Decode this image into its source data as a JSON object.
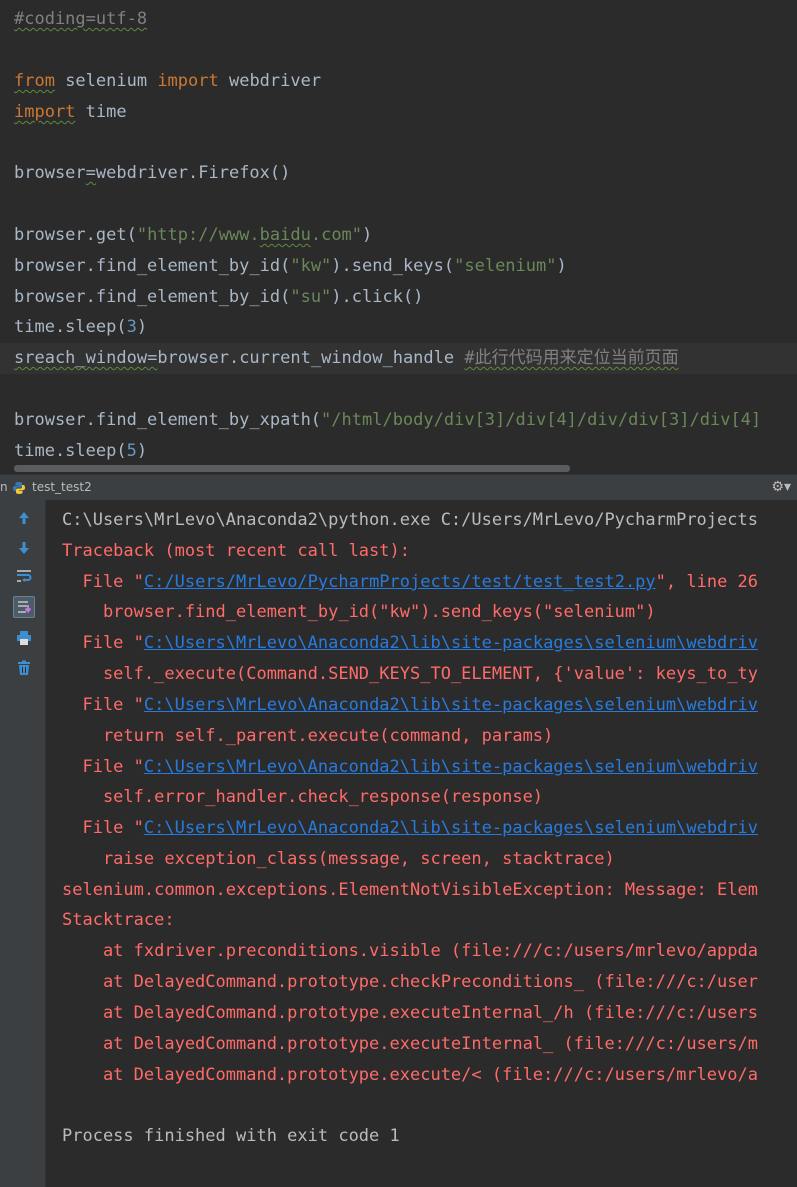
{
  "editor": {
    "lines": {
      "l1": "#coding=utf-8",
      "l3_from": "from",
      "l3_rest": " selenium ",
      "l3_import": "import",
      "l3_mod": " webdriver",
      "l4_import": "import",
      "l4_rest": " time",
      "l6_a": "browser",
      "l6_eq": "=",
      "l6_b": "webdriver.Firefox()",
      "l8_a": "browser.get(",
      "l8_s1": "\"http://www.",
      "l8_s2": "baidu",
      "l8_s3": ".com\"",
      "l8_b": ")",
      "l9_a": "browser.find_element_by_id(",
      "l9_s": "\"kw\"",
      "l9_b": ").send_keys(",
      "l9_s2": "\"selenium\"",
      "l9_c": ")",
      "l10_a": "browser.find_element_by_id(",
      "l10_s": "\"su\"",
      "l10_b": ").click()",
      "l11_a": "time.sleep(",
      "l11_n": "3",
      "l11_b": ")",
      "l12_a": "sreach_window",
      "l12_eq": "=",
      "l12_b": "browser.current_window_handle ",
      "l12_c": "#此行代码用来定位当前页面",
      "l14_a": "browser.find_element_by_xpath(",
      "l14_s": "\"/html/body/div[3]/div[4]/div/div[3]/div[4]",
      "l15_a": "time.sleep(",
      "l15_n": "5",
      "l15_b": ")"
    }
  },
  "run_panel": {
    "prefix": "n",
    "tab_label": "test_test2",
    "gear": "⚙▾"
  },
  "toolbar": {
    "icons": [
      "up-arrow-icon",
      "down-arrow-icon",
      "soft-wrap-icon",
      "scroll-to-end-icon",
      "print-icon",
      "trash-icon"
    ]
  },
  "console": {
    "c1": "C:\\Users\\MrLevo\\Anaconda2\\python.exe C:/Users/MrLevo/PycharmProjects",
    "c2": "Traceback (most recent call last):",
    "c3_pre": "  File ",
    "c3_q1": "\"",
    "c3_link": "C:/Users/MrLevo/PycharmProjects/test/test_test2.py",
    "c3_post": "\", line 26",
    "c4": "    browser.find_element_by_id(\"kw\").send_keys(\"selenium\")",
    "c5_pre": "  File ",
    "c5_q1": "\"",
    "c5_link": "C:\\Users\\MrLevo\\Anaconda2\\lib\\site-packages\\selenium\\webdriv",
    "c6": "    self._execute(Command.SEND_KEYS_TO_ELEMENT, {'value': keys_to_ty",
    "c7_pre": "  File ",
    "c7_q1": "\"",
    "c7_link": "C:\\Users\\MrLevo\\Anaconda2\\lib\\site-packages\\selenium\\webdriv",
    "c8": "    return self._parent.execute(command, params)",
    "c9_pre": "  File ",
    "c9_q1": "\"",
    "c9_link": "C:\\Users\\MrLevo\\Anaconda2\\lib\\site-packages\\selenium\\webdriv",
    "c10": "    self.error_handler.check_response(response)",
    "c11_pre": "  File ",
    "c11_q1": "\"",
    "c11_link": "C:\\Users\\MrLevo\\Anaconda2\\lib\\site-packages\\selenium\\webdriv",
    "c12": "    raise exception_class(message, screen, stacktrace)",
    "c13": "selenium.common.exceptions.ElementNotVisibleException: Message: Elem",
    "c14": "Stacktrace:",
    "c15": "    at fxdriver.preconditions.visible (file:///c:/users/mrlevo/appda",
    "c16": "    at DelayedCommand.prototype.checkPreconditions_ (file:///c:/user",
    "c17": "    at DelayedCommand.prototype.executeInternal_/h (file:///c:/users",
    "c18": "    at DelayedCommand.prototype.executeInternal_ (file:///c:/users/m",
    "c19": "    at DelayedCommand.prototype.execute/< (file:///c:/users/mrlevo/a",
    "c21": "Process finished with exit code 1"
  },
  "colors": {
    "background": "#2b2b2b",
    "keyword": "#cc7832",
    "string": "#6a8759",
    "number": "#6897bb",
    "comment": "#808080",
    "error": "#ff6b68",
    "link": "#287bde"
  }
}
